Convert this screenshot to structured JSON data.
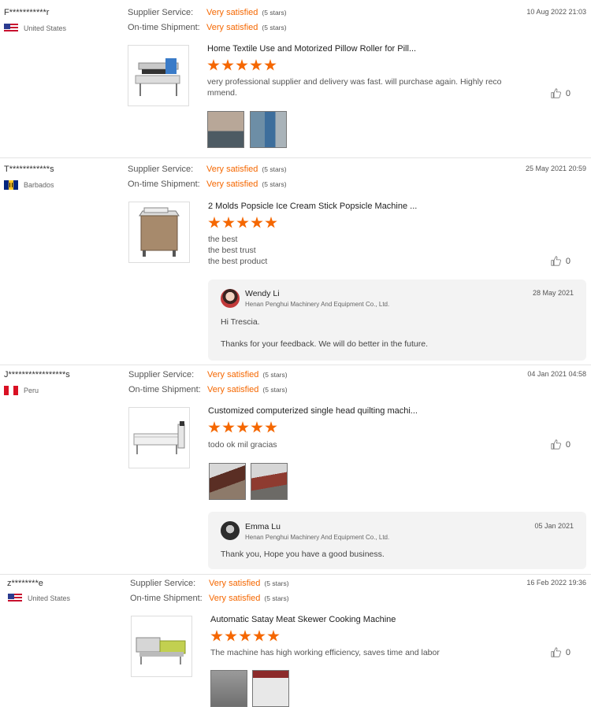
{
  "labels": {
    "supplier_service": "Supplier Service:",
    "ontime_shipment": "On-time Shipment:"
  },
  "colors": {
    "accent": "#f56700",
    "reply_bg": "#f3f3f3"
  },
  "reviews": [
    {
      "buyer": "F***********r",
      "country": "United States",
      "flag_icon": "us-flag-icon",
      "supplier_rating": "Very satisfied",
      "supplier_stars": "(5 stars)",
      "shipment_rating": "Very satisfied",
      "shipment_stars": "(5 stars)",
      "date": "10 Aug 2022 21:03",
      "product_title": "Home Textile Use and Motorized Pillow Roller for Pill...",
      "star_count": 5,
      "comment": "very professional supplier and delivery was fast. will purchase again. Highly reco\nmmend.",
      "likes": "0",
      "photos": 2
    },
    {
      "buyer": "T************s",
      "country": "Barbados",
      "flag_icon": "barbados-flag-icon",
      "supplier_rating": "Very satisfied",
      "supplier_stars": "(5 stars)",
      "shipment_rating": "Very satisfied",
      "shipment_stars": "(5 stars)",
      "date": "25 May 2021 20:59",
      "product_title": "2 Molds Popsicle Ice Cream Stick Popsicle Machine ...",
      "star_count": 5,
      "comment_lines": [
        "the best",
        "the best trust",
        "the best product"
      ],
      "likes": "0",
      "reply": {
        "name": "Wendy Li",
        "company": "Henan Penghui Machinery And Equipment Co., Ltd.",
        "date": "28 May 2021",
        "text_line1": "Hi Trescia.",
        "text_line2": "Thanks for  your feedback. We will do better in the future."
      }
    },
    {
      "buyer": "J*****************s",
      "country": "Peru",
      "flag_icon": "peru-flag-icon",
      "supplier_rating": "Very satisfied",
      "supplier_stars": "(5 stars)",
      "shipment_rating": "Very satisfied",
      "shipment_stars": "(5 stars)",
      "date": "04 Jan 2021 04:58",
      "product_title": "Customized computerized single head quilting machi...",
      "star_count": 5,
      "comment": "todo ok mil gracias",
      "likes": "0",
      "photos": 2,
      "reply": {
        "name": "Emma Lu",
        "company": "Henan Penghui Machinery And Equipment Co., Ltd.",
        "date": "05 Jan 2021",
        "text_line1": "Thank you, Hope you have a good business."
      }
    },
    {
      "buyer": "z********e",
      "country": "United States",
      "flag_icon": "us-flag-icon",
      "supplier_rating": "Very satisfied",
      "supplier_stars": "(5 stars)",
      "shipment_rating": "Very satisfied",
      "shipment_stars": "(5 stars)",
      "date": "16 Feb 2022 19:36",
      "product_title": "Automatic Satay Meat Skewer Cooking Machine",
      "star_count": 5,
      "comment": "The machine has high working efficiency, saves time and labor",
      "likes": "0",
      "photos": 2
    }
  ]
}
